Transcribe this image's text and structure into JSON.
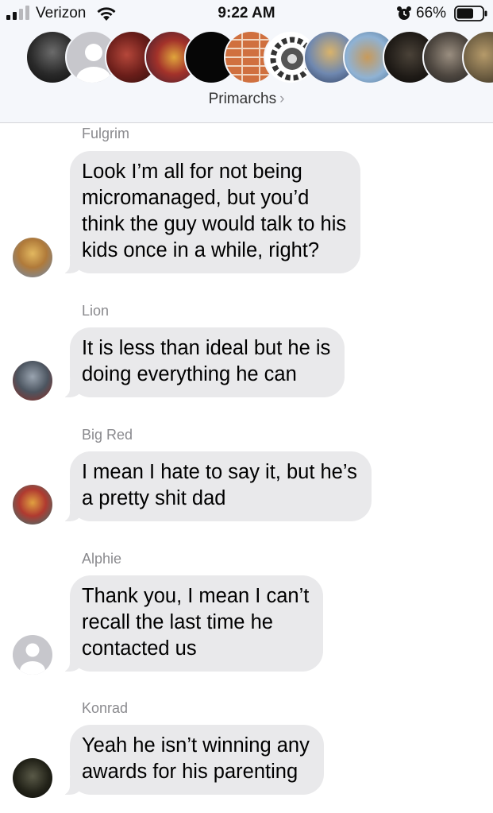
{
  "status_bar": {
    "carrier": "Verizon",
    "time": "9:22 AM",
    "battery_percent": "66%",
    "battery_level": 0.66,
    "signal_bars": 2
  },
  "conversation": {
    "title": "Primarchs",
    "chevron": "›",
    "participant_avatars": [
      "dark-helmet-avatar",
      "default-person-avatar",
      "armored-warrior-red-avatar",
      "warrior-red-gold-avatar",
      "black-avatar",
      "brick-wall-avatar",
      "gear-skull-emblem-avatar",
      "golden-armor-avatar",
      "warrior-blue-sky-avatar",
      "dark-armor-avatar",
      "grey-armor-avatar",
      "partial-armor-avatar"
    ]
  },
  "messages": [
    {
      "sender": "Fulgrim",
      "avatar": "golden-warrior-avatar",
      "lines": [
        "Look I’m all for not being",
        "micromanaged, but you’d",
        "think the guy would talk to his",
        "kids once in a while, right?"
      ]
    },
    {
      "sender": "Lion",
      "avatar": "grey-knight-avatar",
      "lines": [
        "It is less than ideal but he is",
        "doing everything he can"
      ]
    },
    {
      "sender": "Big Red",
      "avatar": "red-sorcerer-avatar",
      "lines": [
        "I mean I hate to say it, but he’s",
        "a pretty shit dad"
      ]
    },
    {
      "sender": "Alphie",
      "avatar": "default-person-avatar",
      "lines": [
        "Thank you, I mean I can’t",
        "recall the last time he",
        "contacted us"
      ]
    },
    {
      "sender": "Konrad",
      "avatar": "dark-figure-avatar",
      "lines": [
        "Yeah he isn’t winning any",
        "awards for his parenting"
      ]
    }
  ],
  "colors": {
    "header_bg": "#f5f7fb",
    "bubble_bg": "#e9e9eb",
    "sender_text": "#8a8a8e"
  }
}
